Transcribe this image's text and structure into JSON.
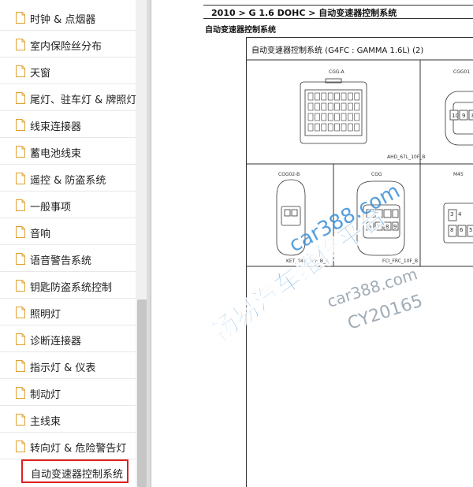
{
  "sidebar": {
    "items": [
      {
        "label": "时钟 & 点烟器"
      },
      {
        "label": "室内保险丝分布"
      },
      {
        "label": "天窗"
      },
      {
        "label": "尾灯、驻车灯 & 牌照灯"
      },
      {
        "label": "线束连接器"
      },
      {
        "label": "蓄电池线束"
      },
      {
        "label": "遥控 & 防盗系统"
      },
      {
        "label": "一般事项"
      },
      {
        "label": "音响"
      },
      {
        "label": "语音警告系统"
      },
      {
        "label": "钥匙防盗系统控制"
      },
      {
        "label": "照明灯"
      },
      {
        "label": "诊断连接器"
      },
      {
        "label": "指示灯 & 仪表"
      },
      {
        "label": "制动灯"
      },
      {
        "label": "主线束"
      },
      {
        "label": "转向灯 & 危险警告灯"
      },
      {
        "label": "自动变速器控制系统",
        "selected": true
      }
    ]
  },
  "content": {
    "breadcrumb": "2010 > G 1.6 DOHC > 自动变速器控制系统",
    "section_title": "自动变速器控制系统",
    "diagram_title": "自动变速器控制系统 (G4FC : GAMMA 1.6L) (2)",
    "connectors": {
      "cgg_a": {
        "name": "CGG-A",
        "code": "AHD_67L_10F_B"
      },
      "cgg01": {
        "name": "CGG01"
      },
      "cgg02_b": {
        "name": "CGG02-B",
        "code": "KET_040_10F_B_A"
      },
      "cgg03": {
        "name": "CGG",
        "code": "FCI_FRC_10F_B"
      },
      "m45": {
        "name": "M45"
      }
    },
    "pin_numbers": {
      "cgg01": [
        "10",
        "9",
        "8"
      ],
      "cgg03": [
        "6",
        "7",
        "8",
        "9"
      ],
      "m45": [
        "3",
        "4",
        "8",
        "6",
        "5"
      ]
    }
  },
  "watermark": {
    "line1": "畅易汽车维修平台",
    "line2": "car388.com",
    "line3": "car388.com",
    "line4": "CY20165",
    "color": "#3a8fd8"
  }
}
